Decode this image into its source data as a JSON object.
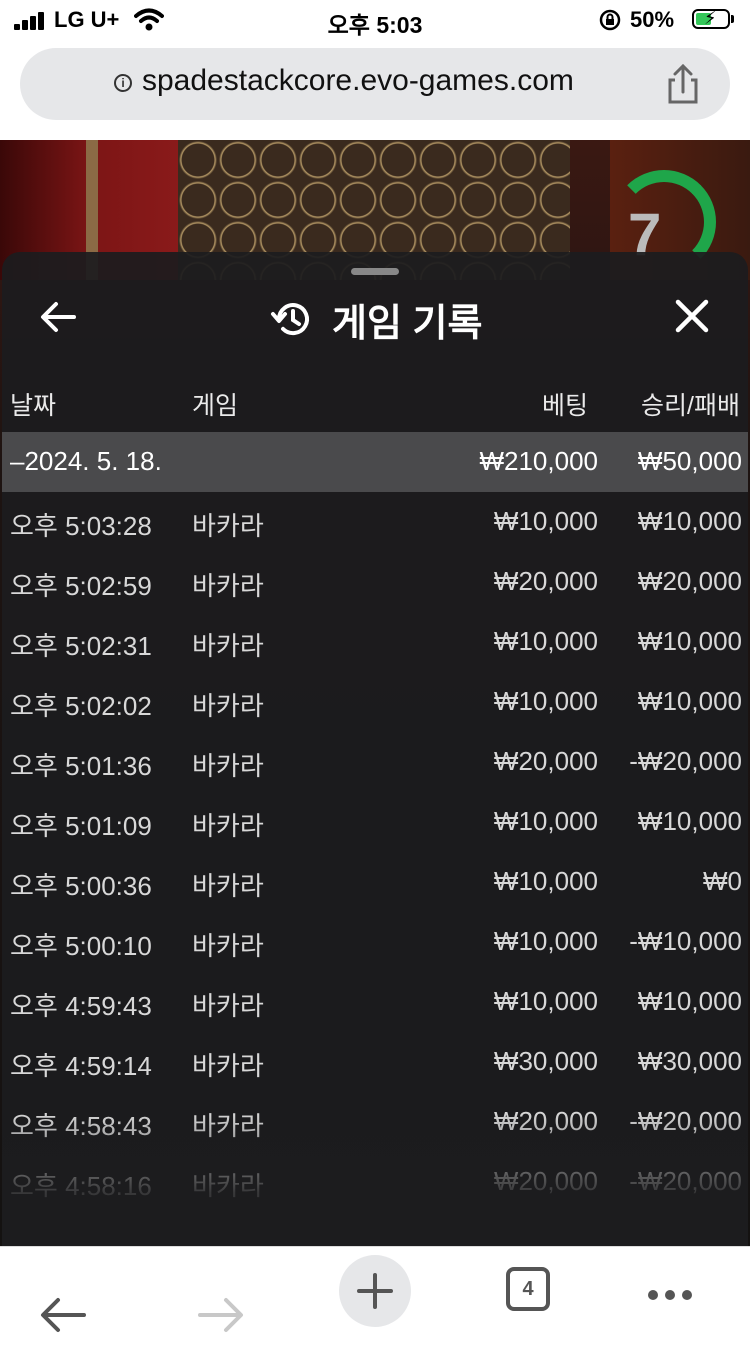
{
  "status_bar": {
    "carrier": "LG U+",
    "time": "오후 5:03",
    "battery": "50%",
    "battery_level": 0.5
  },
  "browser": {
    "url": "spadestackcore.evo-games.com",
    "tab_count": "4"
  },
  "game": {
    "timer": "7"
  },
  "panel": {
    "title": "게임 기록",
    "columns": {
      "date": "날짜",
      "game": "게임",
      "bet": "베팅",
      "winloss": "승리/패배"
    },
    "date_group": {
      "date": "–2024. 5. 18.",
      "bet": "₩210,000",
      "winloss": "₩50,000"
    },
    "rows": [
      {
        "time": "오후 5:03:28",
        "game": "바카라",
        "bet": "₩10,000",
        "winloss": "₩10,000"
      },
      {
        "time": "오후 5:02:59",
        "game": "바카라",
        "bet": "₩20,000",
        "winloss": "₩20,000"
      },
      {
        "time": "오후 5:02:31",
        "game": "바카라",
        "bet": "₩10,000",
        "winloss": "₩10,000"
      },
      {
        "time": "오후 5:02:02",
        "game": "바카라",
        "bet": "₩10,000",
        "winloss": "₩10,000"
      },
      {
        "time": "오후 5:01:36",
        "game": "바카라",
        "bet": "₩20,000",
        "winloss": "-₩20,000"
      },
      {
        "time": "오후 5:01:09",
        "game": "바카라",
        "bet": "₩10,000",
        "winloss": "₩10,000"
      },
      {
        "time": "오후 5:00:36",
        "game": "바카라",
        "bet": "₩10,000",
        "winloss": "₩0"
      },
      {
        "time": "오후 5:00:10",
        "game": "바카라",
        "bet": "₩10,000",
        "winloss": "-₩10,000"
      },
      {
        "time": "오후 4:59:43",
        "game": "바카라",
        "bet": "₩10,000",
        "winloss": "₩10,000"
      },
      {
        "time": "오후 4:59:14",
        "game": "바카라",
        "bet": "₩30,000",
        "winloss": "₩30,000"
      },
      {
        "time": "오후 4:58:43",
        "game": "바카라",
        "bet": "₩20,000",
        "winloss": "-₩20,000"
      },
      {
        "time": "오후 4:58:16",
        "game": "바카라",
        "bet": "₩20,000",
        "winloss": "-₩20,000"
      }
    ]
  }
}
